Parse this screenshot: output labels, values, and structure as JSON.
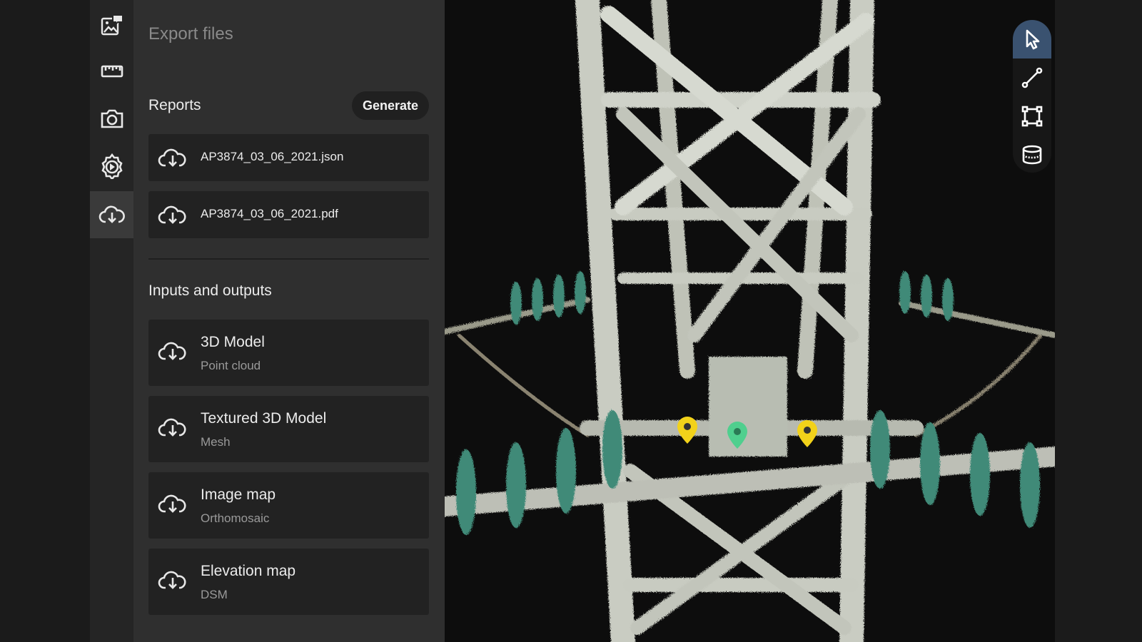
{
  "rail": {
    "items": [
      {
        "icon": "image-annotation-icon"
      },
      {
        "icon": "ruler-icon"
      },
      {
        "icon": "camera-icon"
      },
      {
        "icon": "settings-play-icon"
      },
      {
        "icon": "cloud-download-icon",
        "active": true
      }
    ]
  },
  "panel": {
    "title": "Export files",
    "reports": {
      "title": "Reports",
      "generate_label": "Generate",
      "files": [
        {
          "name": "AP3874_03_06_2021.json"
        },
        {
          "name": "AP3874_03_06_2021.pdf"
        }
      ]
    },
    "io": {
      "title": "Inputs and outputs",
      "items": [
        {
          "title": "3D Model",
          "subtitle": "Point cloud"
        },
        {
          "title": "Textured 3D Model",
          "subtitle": "Mesh"
        },
        {
          "title": "Image map",
          "subtitle": "Orthomosaic"
        },
        {
          "title": "Elevation map",
          "subtitle": "DSM"
        }
      ]
    }
  },
  "toolbar": {
    "tools": [
      {
        "icon": "pointer-icon",
        "active": true
      },
      {
        "icon": "line-measure-icon"
      },
      {
        "icon": "area-measure-icon"
      },
      {
        "icon": "volume-measure-icon"
      }
    ]
  },
  "colors": {
    "accent": "#3a5270",
    "marker_yellow": "#f2d21a",
    "marker_green": "#4fcf8e",
    "insulator_teal": "#3f8a78"
  }
}
